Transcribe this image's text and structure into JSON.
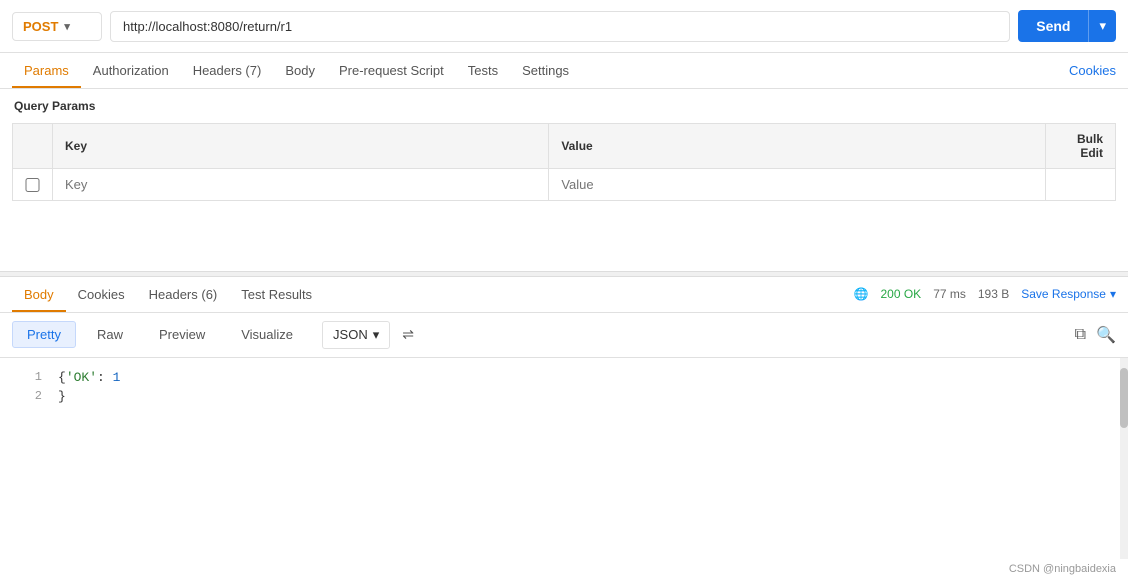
{
  "url_bar": {
    "method": "POST",
    "url": "http://localhost:8080/return/r1",
    "send_label": "Send"
  },
  "request_tabs": {
    "tabs": [
      {
        "label": "Params",
        "active": true
      },
      {
        "label": "Authorization"
      },
      {
        "label": "Headers (7)"
      },
      {
        "label": "Body"
      },
      {
        "label": "Pre-request Script"
      },
      {
        "label": "Tests"
      },
      {
        "label": "Settings"
      }
    ],
    "cookies_label": "Cookies"
  },
  "query_params": {
    "section_label": "Query Params",
    "columns": [
      "",
      "Key",
      "Value",
      "Bulk Edit"
    ],
    "empty_row": {
      "key_placeholder": "Key",
      "value_placeholder": "Value"
    }
  },
  "response": {
    "tabs": [
      {
        "label": "Body",
        "active": true
      },
      {
        "label": "Cookies"
      },
      {
        "label": "Headers (6)"
      },
      {
        "label": "Test Results"
      }
    ],
    "status_code": "200",
    "status_text": "OK",
    "time": "77 ms",
    "size": "193 B",
    "save_response_label": "Save Response"
  },
  "body_view": {
    "tabs": [
      {
        "label": "Pretty",
        "active": true
      },
      {
        "label": "Raw"
      },
      {
        "label": "Preview"
      },
      {
        "label": "Visualize"
      }
    ],
    "format": "JSON"
  },
  "code_content": {
    "lines": [
      {
        "num": "1",
        "content_html": "<span class='json-brace'>{</span><span class='json-key'>'OK'</span><span class='json-colon'>: </span><span class='json-value-num'>1</span>"
      },
      {
        "num": "2",
        "content_html": "<span class='json-brace'>}</span>"
      }
    ]
  },
  "footer": {
    "text": "CSDN @ningbaidexia"
  }
}
